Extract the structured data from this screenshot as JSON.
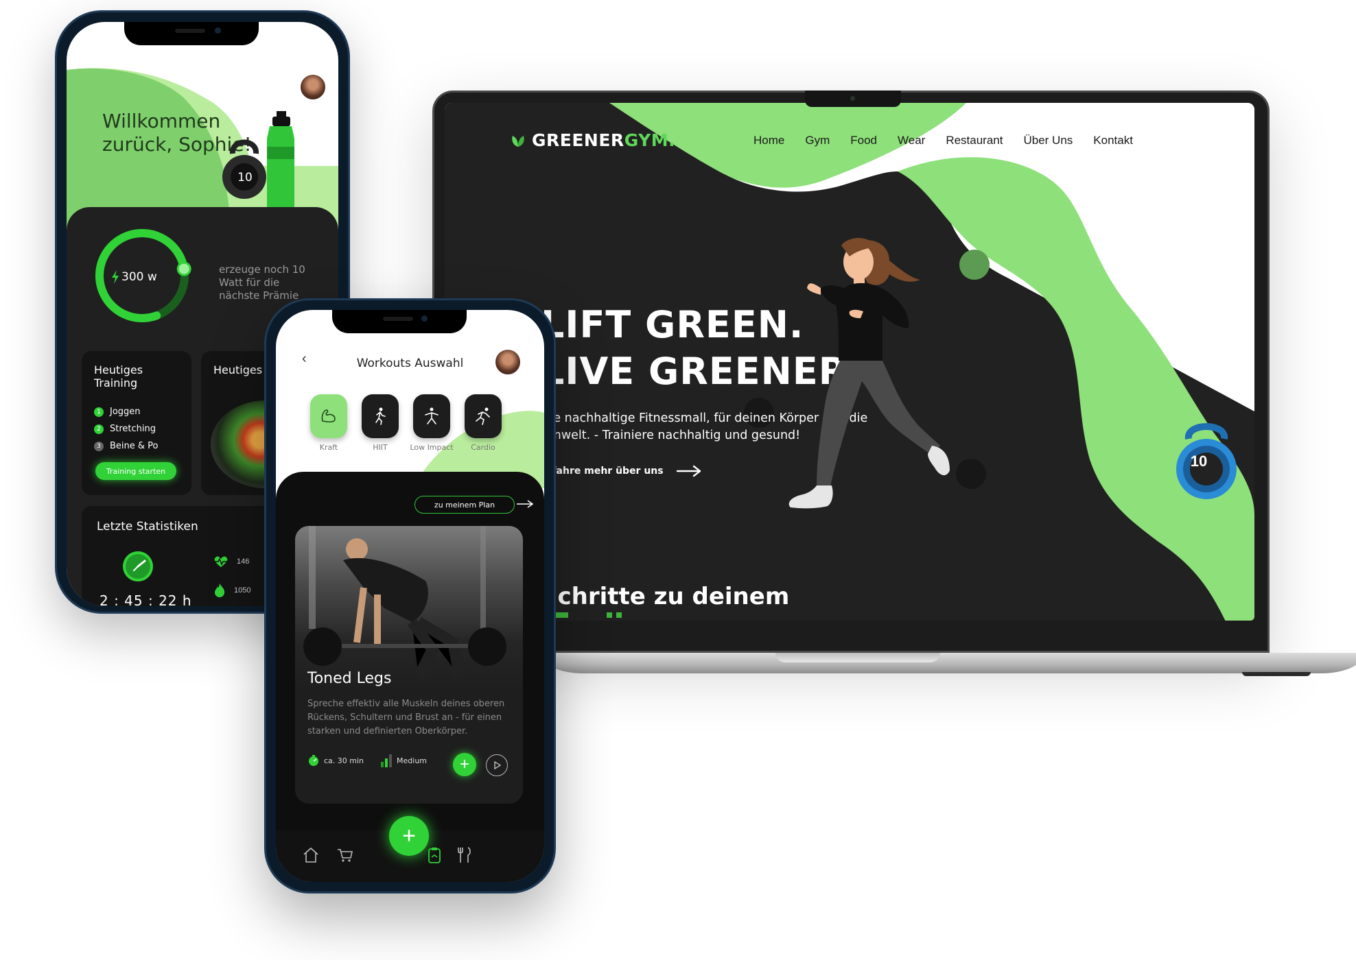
{
  "website": {
    "logo": {
      "part1": "GREENER",
      "part2": "GYM.",
      "brand_green": "#5fd85a"
    },
    "nav": [
      "Home",
      "Gym",
      "Food",
      "Wear",
      "Restaurant",
      "Über Uns",
      "Kontakt"
    ],
    "hero": {
      "title_line1": "LIFT GREEN.",
      "title_line2": "LIVE GREENER.",
      "subtitle": "Die nachhaltige Fitnessmall, für deinen Körper und die Umwelt. - Trainiere nachhaltig und gesund!",
      "link": "Erfahre mehr über uns"
    },
    "section_title": "Schritte zu deinem",
    "kettlebell_number": "10",
    "colors": {
      "dark": "#212121",
      "green": "#8ee07a",
      "deep_green": "#5c9b52"
    }
  },
  "dashboard_app": {
    "greeting": "Willkommen zurück, Sophie!",
    "kettlebell_number": "10",
    "power": {
      "value_label": "300 w",
      "note": "erzeuge noch 10 Watt für die nächste Prämie",
      "progress": 0.78
    },
    "training_card": {
      "title": "Heutiges Training",
      "items": [
        {
          "num": "1",
          "label": "Joggen",
          "done": true
        },
        {
          "num": "2",
          "label": "Stretching",
          "done": true
        },
        {
          "num": "3",
          "label": "Beine & Po",
          "done": false
        }
      ],
      "button": "Training starten"
    },
    "food_card": {
      "title": "Heutiges Essen"
    },
    "stats": {
      "title": "Letzte Statistiken",
      "time": "2 : 45 : 22 h",
      "stat1": "146",
      "stat2": "1050"
    }
  },
  "workout_app": {
    "header_title": "Workouts Auswahl",
    "categories": [
      {
        "label": "Kraft",
        "icon": "muscle-icon",
        "active": true
      },
      {
        "label": "HIIT",
        "icon": "hiit-icon",
        "active": false
      },
      {
        "label": "Low Impact",
        "icon": "low-impact-icon",
        "active": false
      },
      {
        "label": "Cardio",
        "icon": "cardio-icon",
        "active": false
      }
    ],
    "plan_button": "zu meinem Plan",
    "workout": {
      "title": "Toned Legs",
      "description": "Spreche effektiv alle Muskeln deines oberen Rückens, Schultern und Brust an - für einen starken und definierten Oberkörper.",
      "duration": "ca. 30 min",
      "level": "Medium"
    }
  }
}
